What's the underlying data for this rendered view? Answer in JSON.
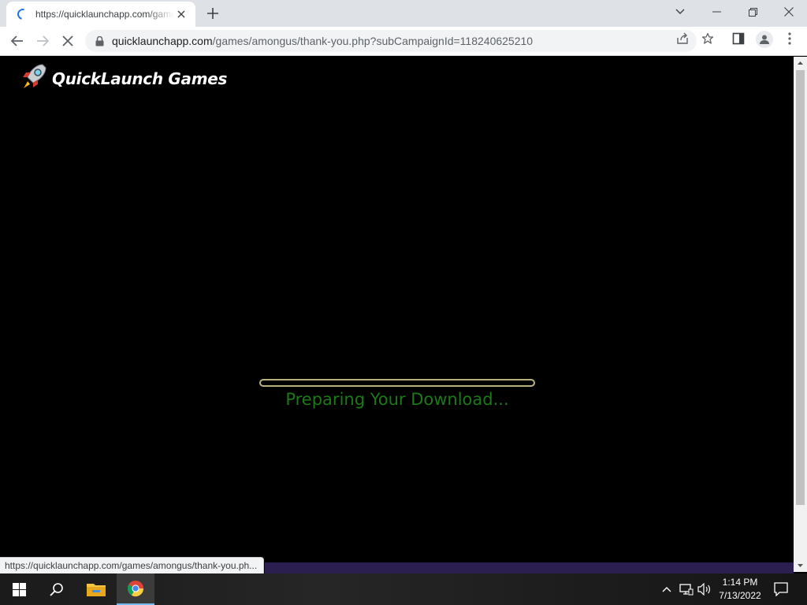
{
  "browser": {
    "tab": {
      "title": "https://quicklaunchapp.com/games/amongus/thank-you.php"
    },
    "address_bar": {
      "host": "quicklaunchapp.com",
      "path": "/games/amongus/thank-you.php?subCampaignId=118240625210"
    },
    "status_url": "https://quicklaunchapp.com/games/amongus/thank-you.ph..."
  },
  "page": {
    "brand": "QuickLaunch Games",
    "progress": {
      "percent": 0
    },
    "status_text": "Preparing Your Download..."
  },
  "taskbar": {
    "time": "1:14 PM",
    "date": "7/13/2022"
  },
  "colors": {
    "progress_border": "#b8b27a",
    "status_text": "#1b7a17",
    "page_bg": "#000000"
  }
}
